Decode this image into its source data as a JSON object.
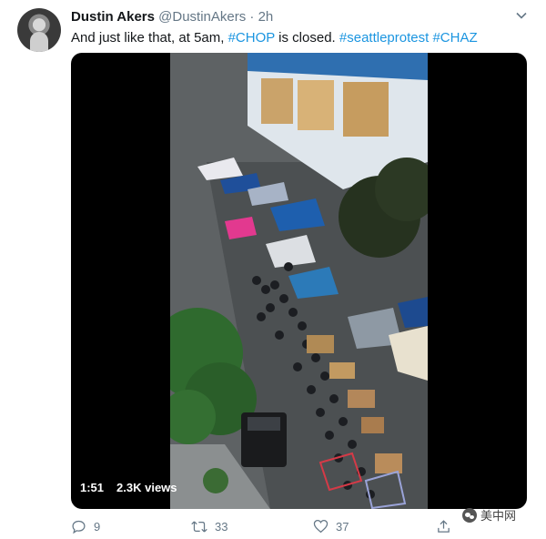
{
  "tweet": {
    "author_name": "Dustin Akers",
    "handle": "@DustinAkers",
    "separator": "·",
    "time": "2h",
    "text_prefix": "And just like that, at 5am, ",
    "hashtag_1": "#CHOP",
    "text_middle": " is closed. ",
    "hashtag_2": "#seattleprotest",
    "hashtag_3": "#CHAZ",
    "caret_icon": "chevron-down-icon"
  },
  "video": {
    "duration": "1:51",
    "views": "2.3K views"
  },
  "actions": {
    "replies": "9",
    "retweets": "33",
    "likes": "37"
  },
  "watermark": {
    "text": "美中网"
  },
  "colors": {
    "link": "#1b95e0",
    "muted": "#657786",
    "text": "#14171a"
  }
}
